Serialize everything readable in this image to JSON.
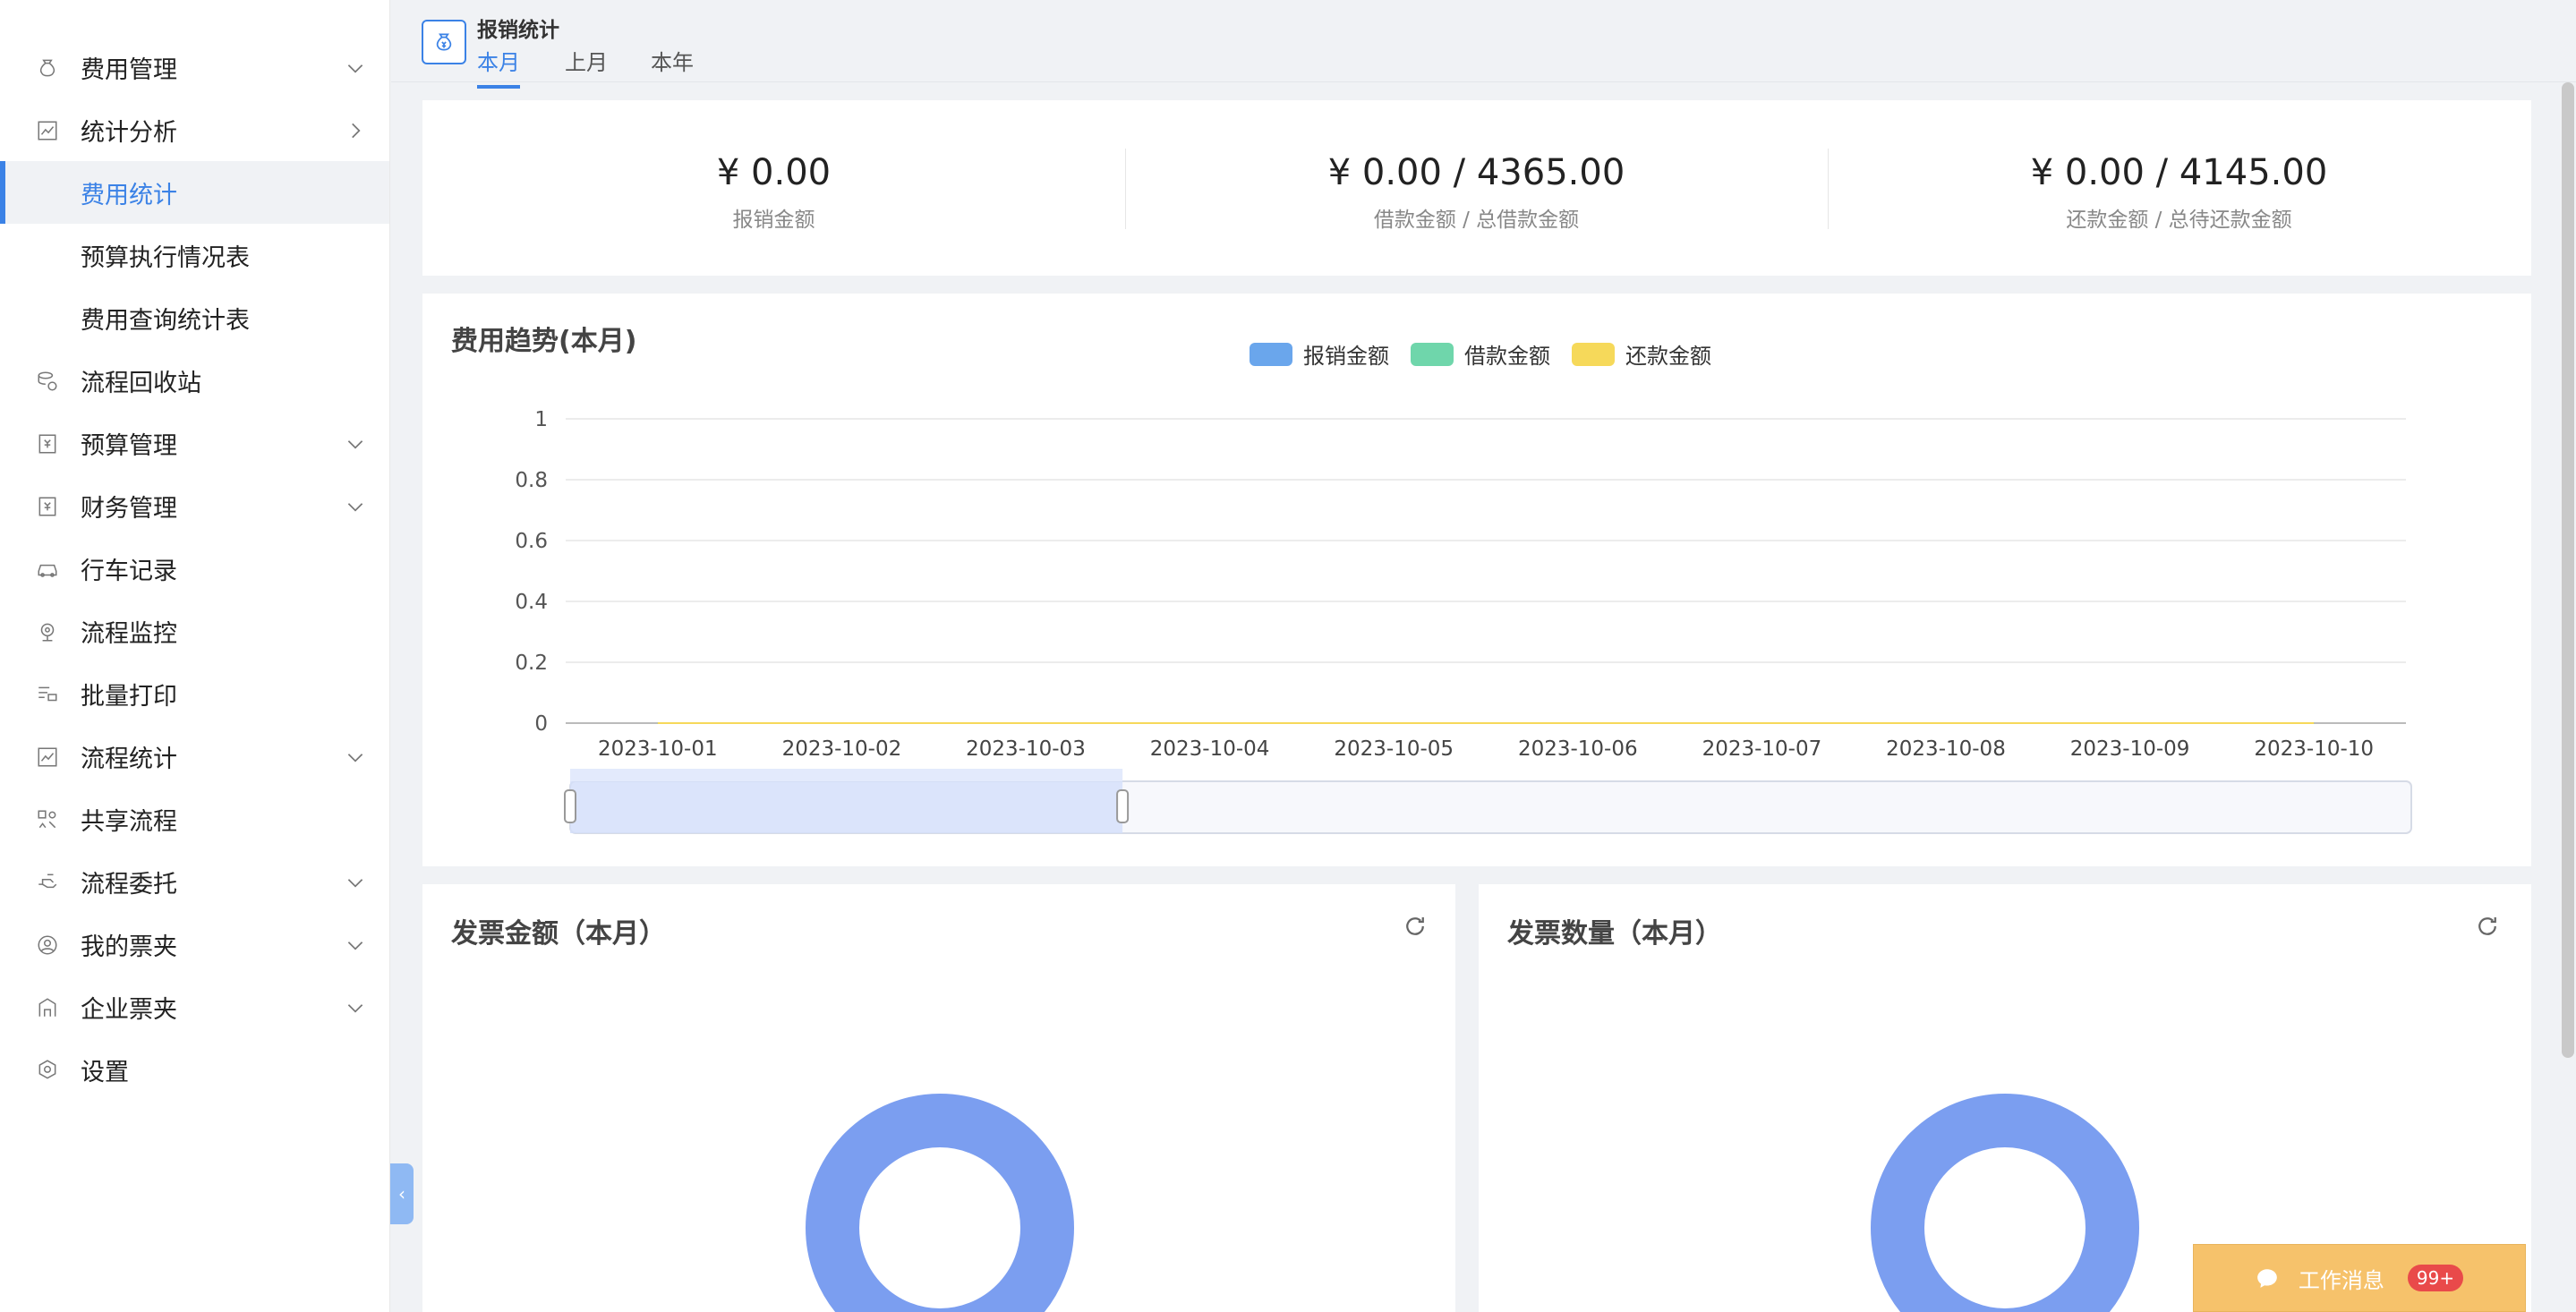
{
  "sidebar": {
    "items": [
      {
        "label": "费用管理",
        "icon": "coin-bag-icon",
        "chevron": "down"
      },
      {
        "label": "统计分析",
        "icon": "chart-icon",
        "chevron": "right"
      },
      {
        "label": "费用统计",
        "sub": true,
        "active": true
      },
      {
        "label": "预算执行情况表",
        "sub": true
      },
      {
        "label": "费用查询统计表",
        "sub": true
      },
      {
        "label": "流程回收站",
        "icon": "recycle-icon"
      },
      {
        "label": "预算管理",
        "icon": "budget-icon",
        "chevron": "down"
      },
      {
        "label": "财务管理",
        "icon": "finance-icon",
        "chevron": "down"
      },
      {
        "label": "行车记录",
        "icon": "car-icon"
      },
      {
        "label": "流程监控",
        "icon": "camera-icon"
      },
      {
        "label": "批量打印",
        "icon": "print-icon"
      },
      {
        "label": "流程统计",
        "icon": "stats-icon",
        "chevron": "down"
      },
      {
        "label": "共享流程",
        "icon": "share-icon"
      },
      {
        "label": "流程委托",
        "icon": "hand-icon",
        "chevron": "down"
      },
      {
        "label": "我的票夹",
        "icon": "user-icon",
        "chevron": "down"
      },
      {
        "label": "企业票夹",
        "icon": "building-icon",
        "chevron": "down"
      },
      {
        "label": "设置",
        "icon": "settings-icon"
      }
    ]
  },
  "header": {
    "title": "报销统计",
    "tabs": [
      {
        "label": "本月",
        "active": true
      },
      {
        "label": "上月"
      },
      {
        "label": "本年"
      }
    ]
  },
  "summary": [
    {
      "value": "¥ 0.00",
      "label": "报销金额"
    },
    {
      "value": "¥ 0.00 / 4365.00",
      "label": "借款金额 / 总借款金额"
    },
    {
      "value": "¥ 0.00 / 4145.00",
      "label": "还款金额 / 总待还款金额"
    }
  ],
  "trend": {
    "title": "费用趋势(本月)"
  },
  "chart_data": {
    "type": "line",
    "x": [
      "2023-10-01",
      "2023-10-02",
      "2023-10-03",
      "2023-10-04",
      "2023-10-05",
      "2023-10-06",
      "2023-10-07",
      "2023-10-08",
      "2023-10-09",
      "2023-10-10"
    ],
    "series": [
      {
        "name": "报销金额",
        "color": "#6aa6ec",
        "values": [
          0,
          0,
          0,
          0,
          0,
          0,
          0,
          0,
          0,
          0
        ]
      },
      {
        "name": "借款金额",
        "color": "#6fd6ab",
        "values": [
          0,
          0,
          0,
          0,
          0,
          0,
          0,
          0,
          0,
          0
        ]
      },
      {
        "name": "还款金额",
        "color": "#f6d95a",
        "values": [
          0,
          0,
          0,
          0,
          0,
          0,
          0,
          0,
          0,
          0
        ]
      }
    ],
    "ylim": [
      0,
      1
    ],
    "yticks": [
      "0",
      "0.2",
      "0.4",
      "0.6",
      "0.8",
      "1"
    ],
    "grid": true,
    "legend": "top-center",
    "zoom_range": [
      0,
      0.3
    ]
  },
  "invoice_amount": {
    "title": "发票金额（本月）",
    "ring_color": "#7b9ef0"
  },
  "invoice_count": {
    "title": "发票数量（本月）",
    "ring_color": "#7b9ef0"
  },
  "message": {
    "label": "工作消息",
    "badge": "99+"
  }
}
